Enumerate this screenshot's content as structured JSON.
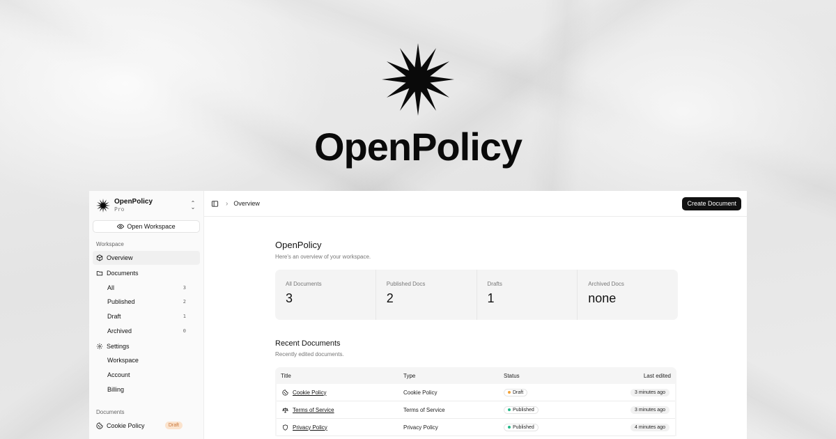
{
  "brand": {
    "name": "OpenPolicy",
    "mark_icon": "starburst-logo-icon"
  },
  "sidebar": {
    "workspace_name": "OpenPolicy",
    "workspace_plan": "Pro",
    "open_workspace_label": "Open Workspace",
    "workspace_group_label": "Workspace",
    "overview_label": "Overview",
    "documents_label": "Documents",
    "document_filters": [
      {
        "label": "All",
        "count": "3"
      },
      {
        "label": "Published",
        "count": "2"
      },
      {
        "label": "Draft",
        "count": "1"
      },
      {
        "label": "Archived",
        "count": "0"
      }
    ],
    "settings_label": "Settings",
    "settings_items": [
      "Workspace",
      "Account",
      "Billing"
    ],
    "documents_group_label": "Documents",
    "recent_doc": {
      "label": "Cookie Policy",
      "badge": "Draft"
    }
  },
  "topbar": {
    "breadcrumb": "Overview",
    "create_label": "Create Document"
  },
  "overview": {
    "title": "OpenPolicy",
    "subtitle": "Here's an overview of your workspace.",
    "stats": [
      {
        "label": "All Documents",
        "value": "3"
      },
      {
        "label": "Published Docs",
        "value": "2"
      },
      {
        "label": "Drafts",
        "value": "1"
      },
      {
        "label": "Archived Docs",
        "value": "none"
      }
    ]
  },
  "recent": {
    "title": "Recent Documents",
    "subtitle": "Recently edited documents.",
    "columns": [
      "Title",
      "Type",
      "Status",
      "Last edited"
    ],
    "rows": [
      {
        "title": "Cookie Policy",
        "type": "Cookie Policy",
        "status": "Draft",
        "edited": "3 minutes ago",
        "icon": "cookie-icon"
      },
      {
        "title": "Terms of Service",
        "type": "Terms of Service",
        "status": "Published",
        "edited": "3 minutes ago",
        "icon": "scale-icon"
      },
      {
        "title": "Privacy Policy",
        "type": "Privacy Policy",
        "status": "Published",
        "edited": "4 minutes ago",
        "icon": "shield-icon"
      }
    ]
  },
  "colors": {
    "accent": "#111111",
    "draft_dot": "#f2a33a",
    "published_dot": "#25b98a",
    "draft_badge_bg": "#fbe3cd"
  }
}
